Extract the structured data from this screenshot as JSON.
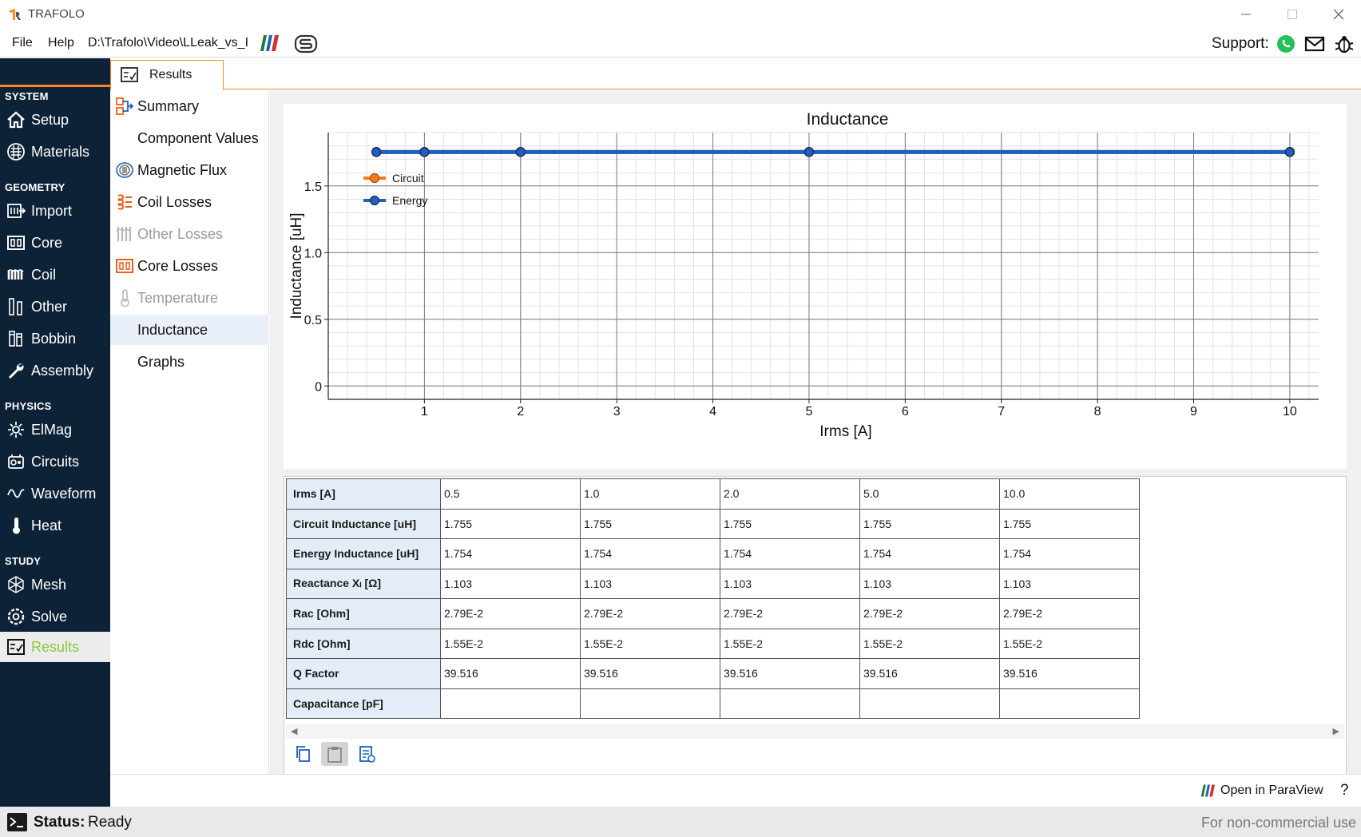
{
  "window": {
    "title": "TRAFOLO"
  },
  "menu": {
    "file": "File",
    "help": "Help",
    "path": "D:\\Trafolo\\Video\\LLeak_vs_I",
    "support_label": "Support:"
  },
  "sidebar": {
    "sections": [
      {
        "label": "SYSTEM",
        "items": [
          {
            "label": "Setup",
            "icon": "home-icon"
          },
          {
            "label": "Materials",
            "icon": "materials-icon"
          }
        ]
      },
      {
        "label": "GEOMETRY",
        "items": [
          {
            "label": "Import",
            "icon": "import-icon"
          },
          {
            "label": "Core",
            "icon": "core-icon"
          },
          {
            "label": "Coil",
            "icon": "coil-icon"
          },
          {
            "label": "Other",
            "icon": "other-icon"
          },
          {
            "label": "Bobbin",
            "icon": "bobbin-icon"
          },
          {
            "label": "Assembly",
            "icon": "wrench-icon"
          }
        ]
      },
      {
        "label": "PHYSICS",
        "items": [
          {
            "label": "ElMag",
            "icon": "elmag-icon"
          },
          {
            "label": "Circuits",
            "icon": "circuits-icon"
          },
          {
            "label": "Waveform",
            "icon": "waveform-icon"
          },
          {
            "label": "Heat",
            "icon": "thermometer-icon"
          }
        ]
      },
      {
        "label": "STUDY",
        "items": [
          {
            "label": "Mesh",
            "icon": "mesh-icon"
          },
          {
            "label": "Solve",
            "icon": "solve-icon"
          },
          {
            "label": "Results",
            "icon": "results-icon",
            "active": true
          }
        ]
      }
    ]
  },
  "tab": {
    "label": "Results"
  },
  "results_nav": [
    {
      "label": "Summary",
      "icon": "summary-icon"
    },
    {
      "label": "Component Values",
      "icon": ""
    },
    {
      "label": "Magnetic Flux",
      "icon": "flux-icon"
    },
    {
      "label": "Coil Losses",
      "icon": "coil-losses-icon"
    },
    {
      "label": "Other Losses",
      "icon": "other-losses-icon",
      "disabled": true
    },
    {
      "label": "Core Losses",
      "icon": "core-losses-icon"
    },
    {
      "label": "Temperature",
      "icon": "thermometer-icon",
      "disabled": true
    },
    {
      "label": "Inductance",
      "icon": "",
      "selected": true
    },
    {
      "label": "Graphs",
      "icon": ""
    }
  ],
  "chart_data": {
    "type": "line",
    "title": "Inductance",
    "xlabel": "Irms [A]",
    "ylabel": "Inductance [uH]",
    "xlim": [
      0,
      10.3
    ],
    "ylim": [
      -0.1,
      1.9
    ],
    "xticks": [
      1,
      2,
      3,
      4,
      5,
      6,
      7,
      8,
      9,
      10
    ],
    "yticks": [
      0,
      0.5,
      1.0,
      1.5
    ],
    "ytick_labels": [
      "0",
      "0.5",
      "1.0",
      "1.5"
    ],
    "grid": true,
    "legend_position": "top-left",
    "series": [
      {
        "name": "Circuit",
        "color": "#f47a20",
        "x": [
          0.5,
          1.0,
          2.0,
          5.0,
          10.0
        ],
        "y": [
          1.755,
          1.755,
          1.755,
          1.755,
          1.755
        ]
      },
      {
        "name": "Energy",
        "color": "#1f5fbf",
        "x": [
          0.5,
          1.0,
          2.0,
          5.0,
          10.0
        ],
        "y": [
          1.754,
          1.754,
          1.754,
          1.754,
          1.754
        ]
      }
    ]
  },
  "table": {
    "rows": [
      {
        "header": "Irms [A]",
        "values": [
          "0.5",
          "1.0",
          "2.0",
          "5.0",
          "10.0"
        ]
      },
      {
        "header": "Circuit Inductance [uH]",
        "values": [
          "1.755",
          "1.755",
          "1.755",
          "1.755",
          "1.755"
        ]
      },
      {
        "header": "Energy Inductance [uH]",
        "values": [
          "1.754",
          "1.754",
          "1.754",
          "1.754",
          "1.754"
        ]
      },
      {
        "header": "Reactance Xₗ [Ω]",
        "values": [
          "1.103",
          "1.103",
          "1.103",
          "1.103",
          "1.103"
        ]
      },
      {
        "header": "Rac [Ohm]",
        "values": [
          "2.79E-2",
          "2.79E-2",
          "2.79E-2",
          "2.79E-2",
          "2.79E-2"
        ]
      },
      {
        "header": "Rdc [Ohm]",
        "values": [
          "1.55E-2",
          "1.55E-2",
          "1.55E-2",
          "1.55E-2",
          "1.55E-2"
        ]
      },
      {
        "header": "Q Factor",
        "values": [
          "39.516",
          "39.516",
          "39.516",
          "39.516",
          "39.516"
        ]
      },
      {
        "header": "Capacitance [pF]",
        "values": [
          "",
          "",
          "",
          "",
          ""
        ]
      }
    ]
  },
  "tools": [
    {
      "icon": "copy-icon"
    },
    {
      "icon": "paste-icon",
      "pressed": true
    },
    {
      "icon": "export-icon"
    }
  ],
  "bottom": {
    "paraview_label": "Open in ParaView",
    "help": "?"
  },
  "status": {
    "label": "Status:",
    "value": "Ready",
    "license": "For non-commercial use"
  },
  "colors": {
    "sidebar_bg": "#0e2237",
    "accent_orange": "#ff8a1f",
    "accent_green": "#8cc63f",
    "circuit_series": "#f47a20",
    "energy_series": "#1f5fbf"
  }
}
